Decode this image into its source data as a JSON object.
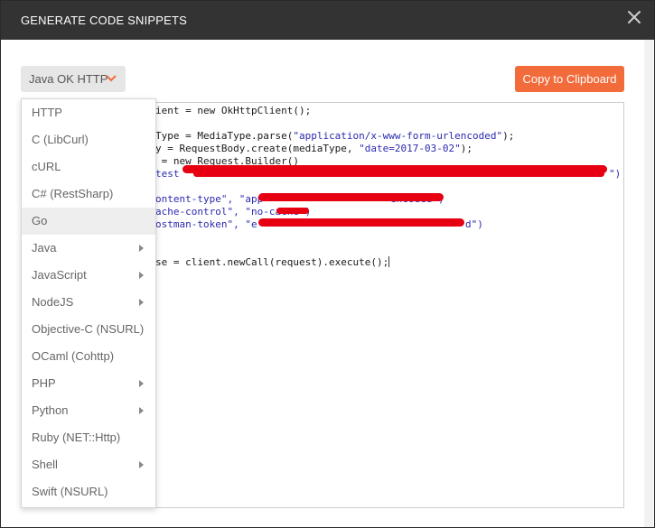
{
  "modal": {
    "title": "GENERATE CODE SNIPPETS",
    "selected_language": "Java OK HTTP",
    "copy_label": "Copy to Clipboard"
  },
  "colors": {
    "header_bg": "#333333",
    "accent": "#f26b3a",
    "string": "#2a2ab0",
    "redaction": "#e60012"
  },
  "icons": {
    "close": "close-icon",
    "chevron": "chevron-down-icon",
    "submenu": "chevron-right-icon"
  },
  "languages": [
    {
      "label": "HTTP",
      "submenu": false
    },
    {
      "label": "C (LibCurl)",
      "submenu": false
    },
    {
      "label": "cURL",
      "submenu": false
    },
    {
      "label": "C# (RestSharp)",
      "submenu": false
    },
    {
      "label": "Go",
      "submenu": false,
      "active": true
    },
    {
      "label": "Java",
      "submenu": true
    },
    {
      "label": "JavaScript",
      "submenu": true
    },
    {
      "label": "NodeJS",
      "submenu": true
    },
    {
      "label": "Objective-C (NSURL)",
      "submenu": false
    },
    {
      "label": "OCaml (Cohttp)",
      "submenu": false
    },
    {
      "label": "PHP",
      "submenu": true
    },
    {
      "label": "Python",
      "submenu": true
    },
    {
      "label": "Ruby (NET::Http)",
      "submenu": false
    },
    {
      "label": "Shell",
      "submenu": true
    },
    {
      "label": "Swift (NSURL)",
      "submenu": false
    }
  ],
  "code": {
    "line1": "ient = new OkHttpClient();",
    "line3_a": "Type = MediaType.parse(",
    "line3_b": "\"application/x-www-form-urlencoded\"",
    "line3_c": ");",
    "line4_a": "y = RequestBody.create(mediaType, ",
    "line4_b": "\"date=2017-03-02\"",
    "line4_c": ");",
    "line5": " = new Request.Builder()",
    "line6_a": "test",
    "line6_b": "\")",
    "line8_a": "ontent-type\", \"",
    "line8_b": "app",
    "line8_c": "encoded\")",
    "line9_a": "ache-control\", \"",
    "line9_b": "no-cache",
    "line9_c": "\")",
    "line10_a": "ostman-token\", \"",
    "line10_b": "e",
    "line10_c": "d\")",
    "line13": "se = client.newCall(request).execute();"
  }
}
